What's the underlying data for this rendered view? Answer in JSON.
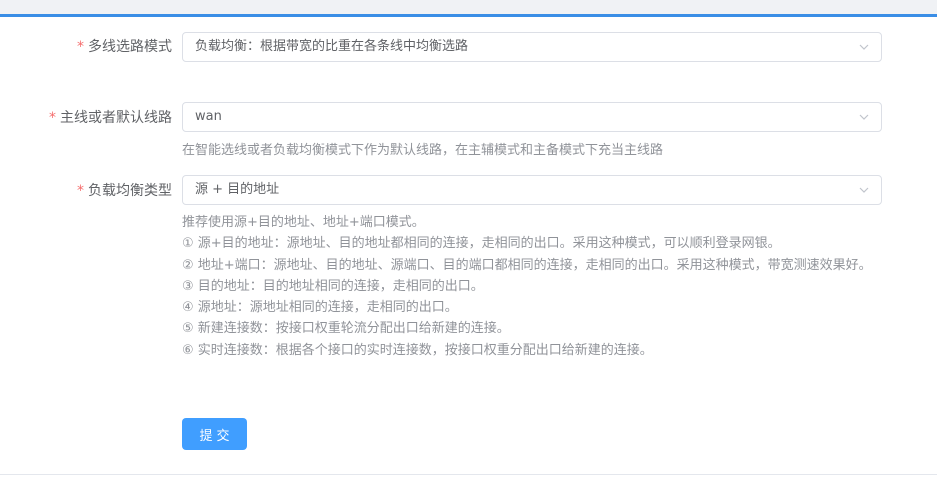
{
  "form": {
    "fields": [
      {
        "label": "多线选路模式",
        "required_mark": "*",
        "value": "负载均衡：根据带宽的比重在各条线中均衡选路"
      },
      {
        "label": "主线或者默认线路",
        "required_mark": "*",
        "value": "wan",
        "help": "在智能选线或者负载均衡模式下作为默认线路，在主辅模式和主备模式下充当主线路"
      },
      {
        "label": "负载均衡类型",
        "required_mark": "*",
        "value": "源 + 目的地址",
        "help_lines": [
          "推荐使用源+目的地址、地址+端口模式。",
          "① 源+目的地址：源地址、目的地址都相同的连接，走相同的出口。采用这种模式，可以顺利登录网银。",
          "② 地址+端口：源地址、目的地址、源端口、目的端口都相同的连接，走相同的出口。采用这种模式，带宽测速效果好。",
          "③ 目的地址：目的地址相同的连接，走相同的出口。",
          "④ 源地址：源地址相同的连接，走相同的出口。",
          "⑤ 新建连接数：按接口权重轮流分配出口给新建的连接。",
          "⑥ 实时连接数：根据各个接口的实时连接数，按接口权重分配出口给新建的连接。"
        ]
      }
    ],
    "submit_label": "提交"
  },
  "colors": {
    "accent": "#409eff",
    "required": "#f56c6c",
    "label": "#606266",
    "help": "#909399",
    "border": "#dcdfe6"
  },
  "icons": {
    "select_arrow": "chevron-down-icon"
  }
}
